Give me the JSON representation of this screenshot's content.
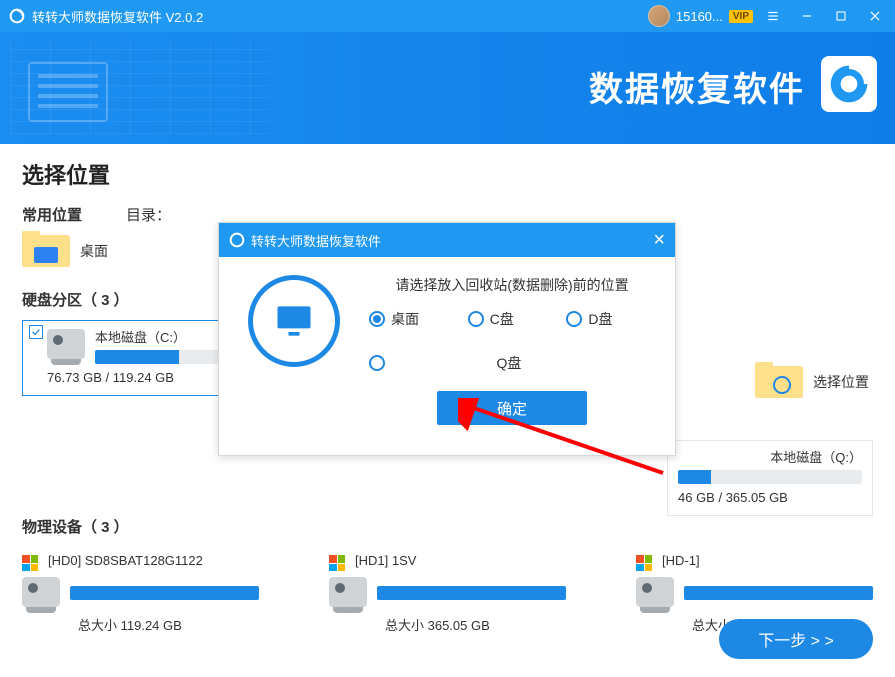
{
  "titlebar": {
    "title": "转转大师数据恢复软件 V2.0.2",
    "user_id": "15160...",
    "vip": "VIP"
  },
  "banner": {
    "text": "数据恢复软件"
  },
  "headings": {
    "choose_location": "选择位置",
    "freq": "常用位置",
    "catalog": "目录：",
    "partitions_label": "硬盘分区（ 3 ）",
    "devices_label": "物理设备（ 3 ）"
  },
  "freq_items": {
    "desktop": "桌面",
    "select_location": "选择位置"
  },
  "partitions": [
    {
      "name": "本地磁盘（C:）",
      "size": "76.73 GB / 119.24 GB",
      "fill": 42
    },
    {
      "name": "本地磁盘（Q:）",
      "size": "46 GB / 365.05 GB",
      "fill": 18,
      "tail": true
    }
  ],
  "devices": [
    {
      "name": "[HD0] SD8SBAT128G1122",
      "size": "总大小 119.24 GB"
    },
    {
      "name": "[HD1] 1SV",
      "size": "总大小 365.05 GB"
    },
    {
      "name": "[HD-1]",
      "size": "总大小 365.05 GB"
    }
  ],
  "next_button": "下一步 > >",
  "modal": {
    "title": "转转大师数据恢复软件",
    "prompt": "请选择放入回收站(数据删除)前的位置",
    "options": {
      "desktop": "桌面",
      "c": "C盘",
      "d": "D盘",
      "q": "Q盘"
    },
    "confirm": "确定"
  }
}
